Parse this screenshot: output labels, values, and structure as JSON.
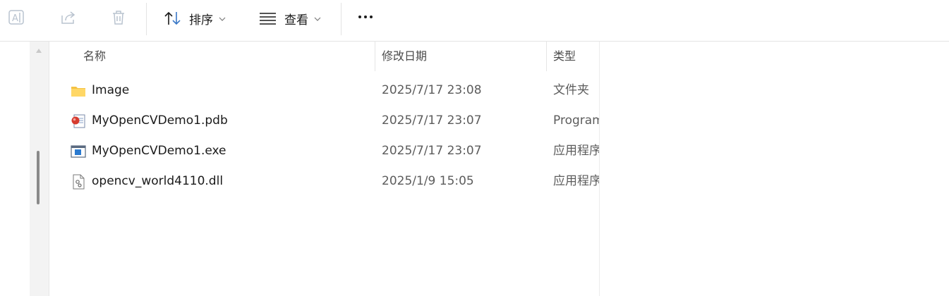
{
  "toolbar": {
    "icons": [
      "rename-icon",
      "share-icon",
      "delete-icon"
    ],
    "sort_label": "排序",
    "view_label": "查看",
    "more_icon": "more-icon"
  },
  "columns": {
    "name": "名称",
    "date": "修改日期",
    "type": "类型"
  },
  "files": [
    {
      "name": "Image",
      "date": "2025/7/17 23:08",
      "type": "文件夹",
      "icon": "folder-icon"
    },
    {
      "name": "MyOpenCVDemo1.pdb",
      "date": "2025/7/17 23:07",
      "type": "Program",
      "icon": "pdb-file-icon"
    },
    {
      "name": "MyOpenCVDemo1.exe",
      "date": "2025/7/17 23:07",
      "type": "应用程序",
      "icon": "exe-file-icon"
    },
    {
      "name": "opencv_world4110.dll",
      "date": "2025/1/9 15:05",
      "type": "应用程序",
      "icon": "dll-file-icon"
    }
  ]
}
